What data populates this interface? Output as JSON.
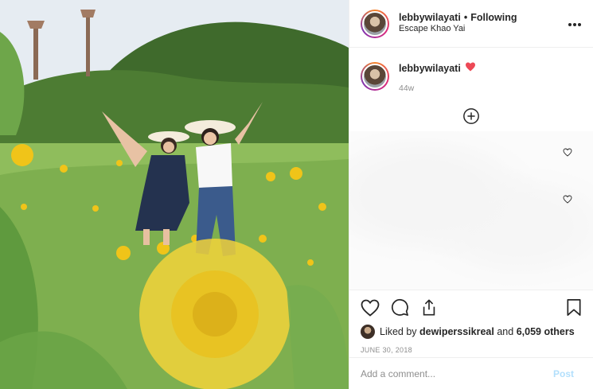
{
  "header": {
    "username": "lebbywilayati",
    "separator": "•",
    "follow_status": "Following",
    "location": "Escape Khao Yai",
    "more_icon": "more-horizontal-icon"
  },
  "caption": {
    "username": "lebbywilayati",
    "timestamp": "44w",
    "heart_color": "#ed4956"
  },
  "comments_area": {
    "load_more_icon": "plus-circle-icon"
  },
  "actions": {
    "like_icon": "heart-icon",
    "comment_icon": "comment-icon",
    "share_icon": "share-icon",
    "save_icon": "bookmark-icon"
  },
  "likes": {
    "prefix": "Liked by",
    "user": "dewiperssikreal",
    "middle": "and",
    "count": "6,059 others"
  },
  "date": "JUNE 30, 2018",
  "comment_box": {
    "placeholder": "Add a comment...",
    "post_label": "Post"
  },
  "colors": {
    "post_button": "#b2dffc",
    "muted_text": "#8e8e8e",
    "text": "#262626"
  }
}
